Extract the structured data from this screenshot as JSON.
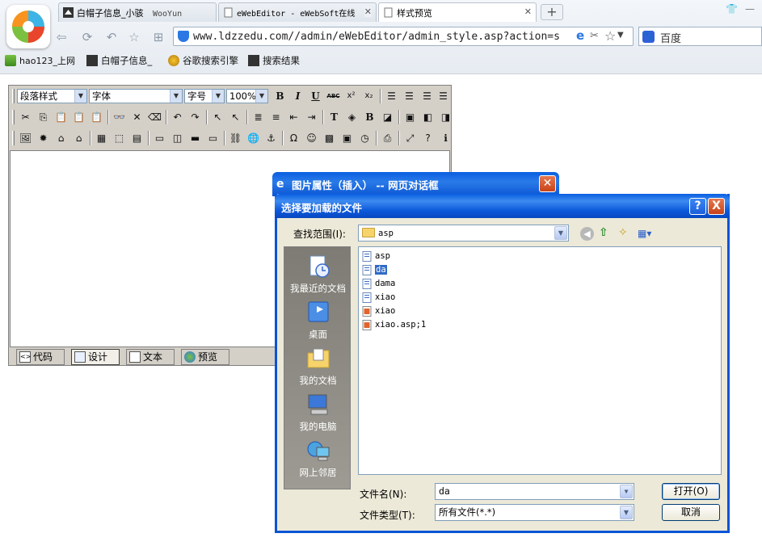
{
  "browser": {
    "tabs": [
      {
        "label": "白帽子信息_小骇",
        "extra": "WooYun"
      },
      {
        "label": "eWebEditor - eWebSoft在线"
      },
      {
        "label": "样式预览"
      }
    ],
    "new_tab": "+",
    "url": "www.ldzzedu.com//admin/eWebEditor/admin_style.asp?action=s",
    "search_engine": "百度",
    "bookmarks": [
      "hao123_上网",
      "白帽子信息_",
      "谷歌搜索引擎",
      "搜索结果"
    ]
  },
  "editor": {
    "combos": {
      "paragraph": "段落样式",
      "font": "字体",
      "size": "字号",
      "zoom": "100%"
    },
    "row1_buttons": [
      "B",
      "I",
      "U",
      "ABC",
      "x²",
      "x₂"
    ],
    "modes": [
      "代码",
      "设计",
      "文本",
      "预览"
    ],
    "active_mode": "设计"
  },
  "back_dialog": {
    "title": "图片属性（插入） -- 网页对话框"
  },
  "file_dialog": {
    "title": "选择要加载的文件",
    "help": "?",
    "close": "X",
    "look_in_label": "查找范围(I):",
    "look_in_value": "asp",
    "places": [
      "我最近的文档",
      "桌面",
      "我的文档",
      "我的电脑",
      "网上邻居"
    ],
    "files": [
      {
        "name": "asp",
        "type": "doc"
      },
      {
        "name": "da",
        "type": "doc",
        "selected": true
      },
      {
        "name": "dama",
        "type": "doc"
      },
      {
        "name": "xiao",
        "type": "doc"
      },
      {
        "name": "xiao",
        "type": "img"
      },
      {
        "name": "xiao.asp;1",
        "type": "img"
      }
    ],
    "filename_label": "文件名(N):",
    "filename_value": "da",
    "filetype_label": "文件类型(T):",
    "filetype_value": "所有文件(*.*)",
    "open_button": "打开(O)",
    "cancel_button": "取消"
  },
  "colors": {
    "xp_blue": "#0a54d6",
    "select": "#316ac5",
    "dialog_bg": "#ece9d8"
  }
}
